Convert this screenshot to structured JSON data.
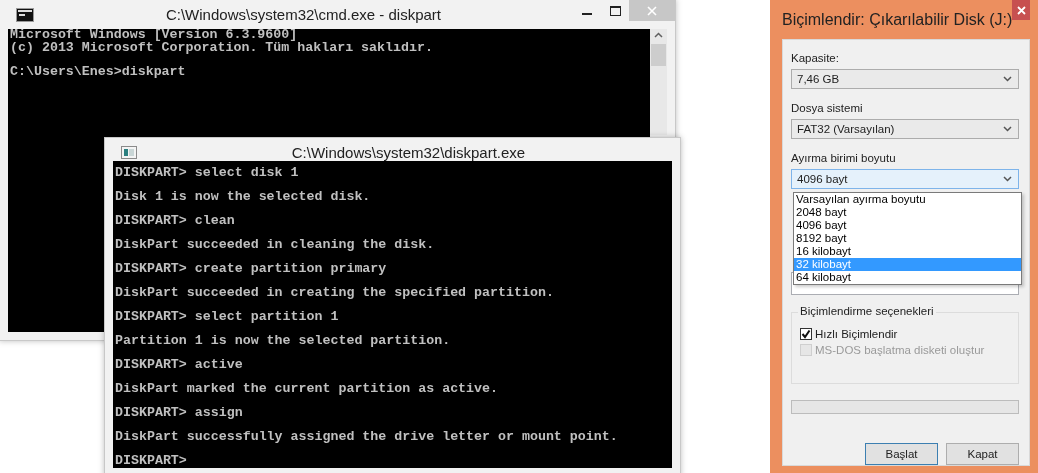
{
  "cmd_window": {
    "title": "C:\\Windows\\system32\\cmd.exe - diskpart",
    "blocks": [
      [
        "Microsoft Windows [Version 6.3.9600]",
        "(c) 2013 Microsoft Corporation. Tüm hakları saklıdır."
      ],
      [
        "C:\\Users\\Enes>diskpart"
      ]
    ]
  },
  "diskpart_window": {
    "title": "C:\\Windows\\system32\\diskpart.exe",
    "lines": [
      "DISKPART> select disk 1",
      "Disk 1 is now the selected disk.",
      "DISKPART> clean",
      "DiskPart succeeded in cleaning the disk.",
      "DISKPART> create partition primary",
      "DiskPart succeeded in creating the specified partition.",
      "DISKPART> select partition 1",
      "Partition 1 is now the selected partition.",
      "DISKPART> active",
      "DiskPart marked the current partition as active.",
      "DISKPART> assign",
      "DiskPart successfully assigned the drive letter or mount point.",
      "DISKPART>"
    ]
  },
  "format_dialog": {
    "title": "Biçimlendir: Çıkarılabilir Disk (J:)",
    "fields": [
      {
        "label": "Kapasite:",
        "value": "7,46 GB",
        "focused": false
      },
      {
        "label": "Dosya sistemi",
        "value": "FAT32 (Varsayılan)",
        "focused": false
      },
      {
        "label": "Ayırma birimi boyutu",
        "value": "4096 bayt",
        "focused": true
      }
    ],
    "dropdown_options": [
      {
        "label": "Varsayılan ayırma boyutu",
        "selected": false
      },
      {
        "label": "2048 bayt",
        "selected": false
      },
      {
        "label": "4096 bayt",
        "selected": false
      },
      {
        "label": "8192 bayt",
        "selected": false
      },
      {
        "label": "16 kilobayt",
        "selected": false
      },
      {
        "label": "32 kilobayt",
        "selected": true
      },
      {
        "label": "64 kilobayt",
        "selected": false
      }
    ],
    "options_group": {
      "title": "Biçimlendirme seçenekleri",
      "checkboxes": [
        {
          "label": "Hızlı Biçimlendir",
          "checked": true,
          "disabled": false
        },
        {
          "label": "MS-DOS başlatma disketi oluştur",
          "checked": false,
          "disabled": true
        }
      ]
    },
    "progress": {
      "level": 0
    },
    "buttons": [
      {
        "label": "Başlat",
        "default": true
      },
      {
        "label": "Kapat",
        "default": false
      }
    ]
  }
}
